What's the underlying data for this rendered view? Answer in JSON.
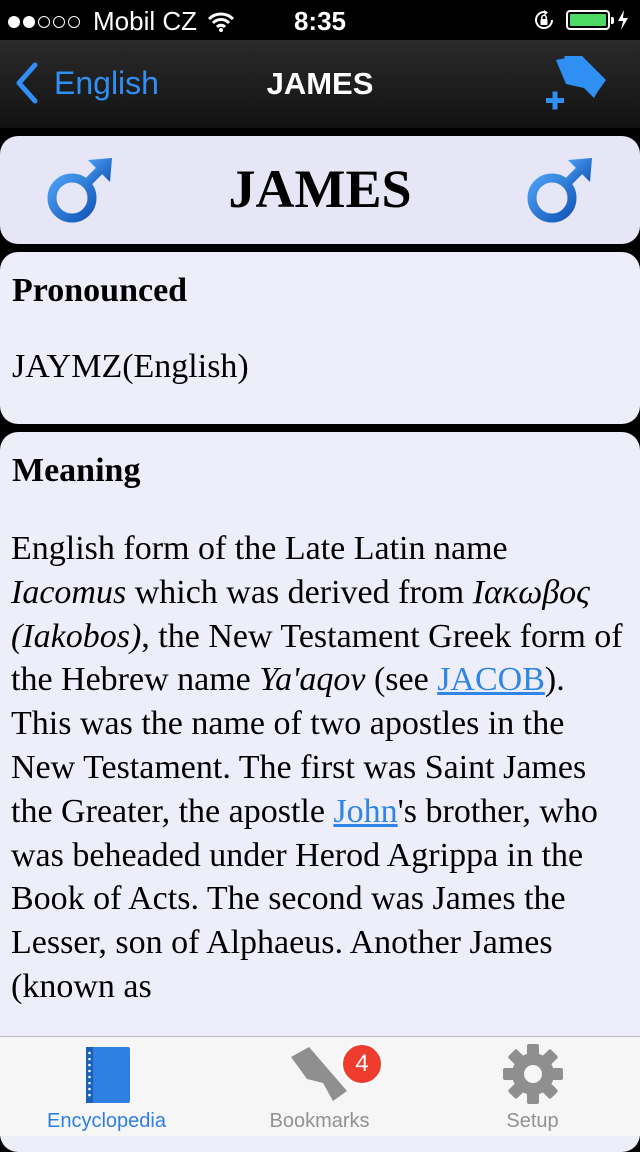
{
  "status_bar": {
    "carrier": "Mobil CZ",
    "time": "8:35",
    "signal_strength_dots": 2,
    "signal_total_dots": 5,
    "battery_level": 1.0,
    "battery_color": "#4cd964"
  },
  "nav_bar": {
    "back_label": "English",
    "title": "JAMES",
    "accent_color": "#2f8ff3",
    "right_icon": "bookmark-add-icon"
  },
  "name_card": {
    "title": "JAMES",
    "gender_icon": "male-symbol-icon"
  },
  "pronounced": {
    "heading": "Pronounced",
    "value": "JAYMZ(English)"
  },
  "meaning": {
    "heading": "Meaning",
    "t1": "English form of the Late Latin name ",
    "i1": "Iacomus",
    "t2": " which was derived from ",
    "i2": "Ιακωβος (Iakobos)",
    "t3": ", the New Testament Greek form of the Hebrew name ",
    "i3": "Ya'aqov",
    "t4": " (see ",
    "link1": "JACOB",
    "t5": "). This was the name of two apostles in the New Testament. The first was Saint James the Greater, the apostle ",
    "link2": "John",
    "t6": "'s brother, who was beheaded under Herod Agrippa in the Book of Acts. The second was James the Lesser, son of Alphaeus. Another James (known as",
    "link_color": "#2f86e6"
  },
  "tab_bar": {
    "tabs": [
      {
        "label": "Encyclopedia",
        "icon": "book-icon",
        "active": true
      },
      {
        "label": "Bookmarks",
        "icon": "bookmark-icon",
        "badge": "4"
      },
      {
        "label": "Setup",
        "icon": "gear-icon"
      }
    ],
    "active_color": "#2f7fe2",
    "inactive_color": "#929292",
    "badge_color": "#f03b2f"
  }
}
